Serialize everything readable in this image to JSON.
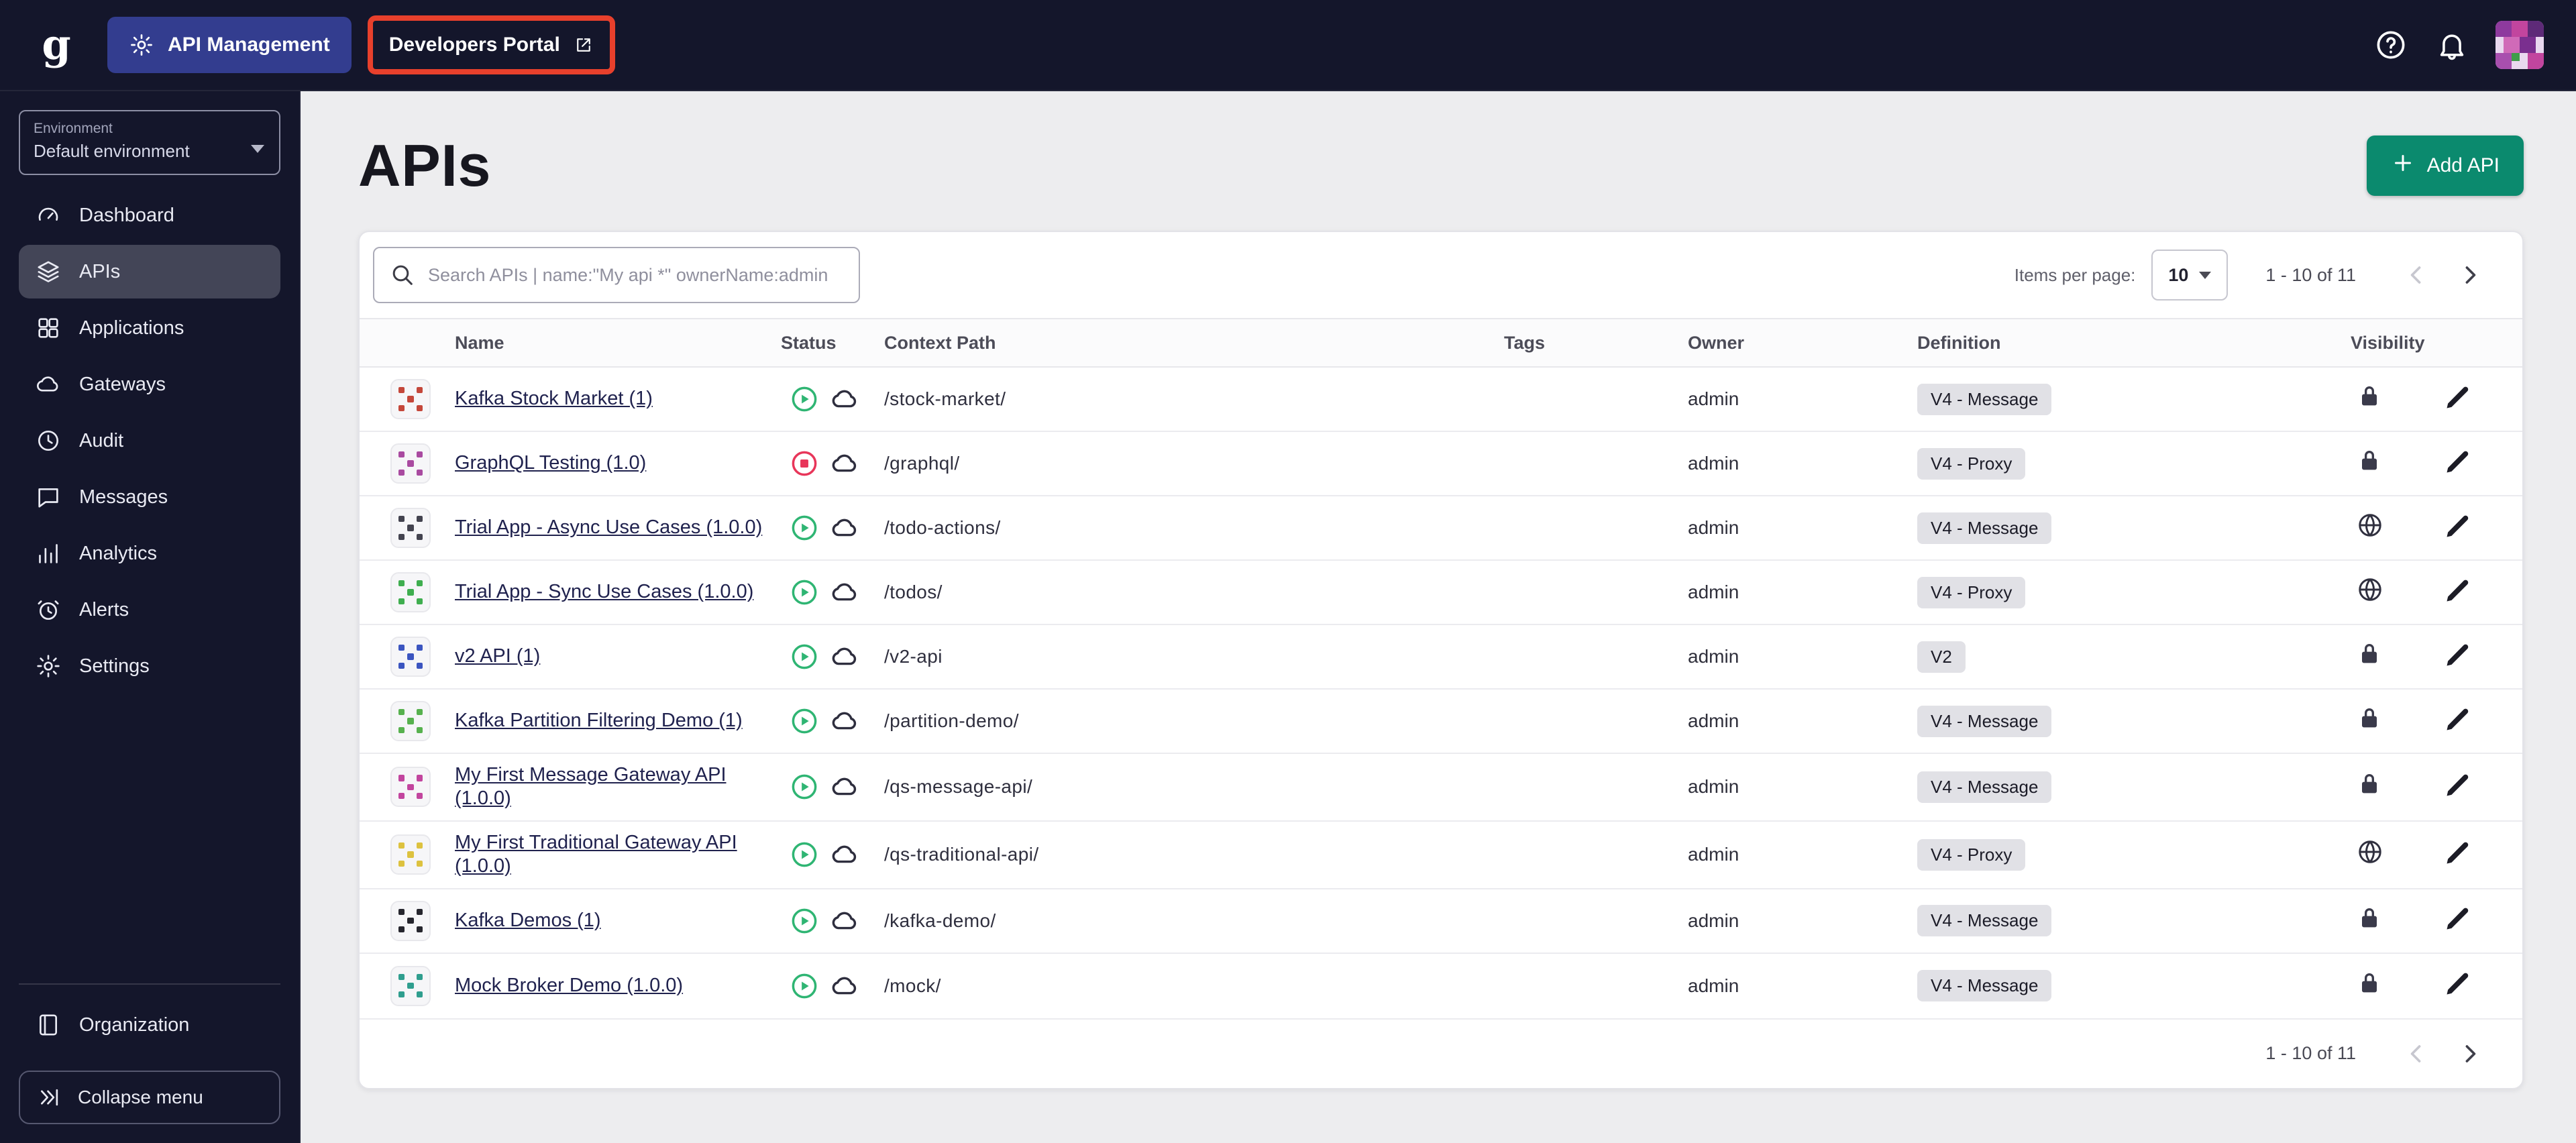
{
  "topbar": {
    "app_label": "API Management",
    "portal_label": "Developers Portal",
    "annotation_color": "#e8402c"
  },
  "sidebar": {
    "environment_label": "Environment",
    "environment_value": "Default environment",
    "items": [
      {
        "label": "Dashboard",
        "icon": "dashboard",
        "active": false
      },
      {
        "label": "APIs",
        "icon": "apis",
        "active": true
      },
      {
        "label": "Applications",
        "icon": "applications",
        "active": false
      },
      {
        "label": "Gateways",
        "icon": "gateways",
        "active": false
      },
      {
        "label": "Audit",
        "icon": "audit",
        "active": false
      },
      {
        "label": "Messages",
        "icon": "messages",
        "active": false
      },
      {
        "label": "Analytics",
        "icon": "analytics",
        "active": false
      },
      {
        "label": "Alerts",
        "icon": "alerts",
        "active": false
      },
      {
        "label": "Settings",
        "icon": "settings",
        "active": false
      }
    ],
    "bottom_items": [
      {
        "label": "Organization",
        "icon": "organization",
        "active": false
      }
    ],
    "collapse_label": "Collapse menu"
  },
  "main": {
    "title": "APIs",
    "add_button_label": "Add API",
    "search_placeholder": "Search APIs | name:\"My api *\" ownerName:admin",
    "pagination": {
      "items_per_page_label": "Items per page:",
      "page_size": "10",
      "range": "1 - 10 of 11"
    },
    "footer": {
      "range": "1 - 10 of 11"
    },
    "table": {
      "headers": [
        "Name",
        "Status",
        "Context Path",
        "Tags",
        "Owner",
        "Definition",
        "Visibility"
      ],
      "rows": [
        {
          "name": "Kafka Stock Market (1)",
          "status": "started",
          "context_path": "/stock-market/",
          "tags": "",
          "owner": "admin",
          "definition": "V4 - Message",
          "visibility": "private",
          "avatar_color": "#c4473a"
        },
        {
          "name": "GraphQL Testing (1.0)",
          "status": "stopped",
          "context_path": "/graphql/",
          "tags": "",
          "owner": "admin",
          "definition": "V4 - Proxy",
          "visibility": "private",
          "avatar_color": "#a94aa0"
        },
        {
          "name": "Trial App - Async Use Cases (1.0.0)",
          "status": "started",
          "context_path": "/todo-actions/",
          "tags": "",
          "owner": "admin",
          "definition": "V4 - Message",
          "visibility": "public",
          "avatar_color": "#43434f"
        },
        {
          "name": "Trial App - Sync Use Cases (1.0.0)",
          "status": "started",
          "context_path": "/todos/",
          "tags": "",
          "owner": "admin",
          "definition": "V4 - Proxy",
          "visibility": "public",
          "avatar_color": "#3fae4f"
        },
        {
          "name": "v2 API (1)",
          "status": "started",
          "context_path": "/v2-api",
          "tags": "",
          "owner": "admin",
          "definition": "V2",
          "visibility": "private",
          "avatar_color": "#3b55c0"
        },
        {
          "name": "Kafka Partition Filtering Demo (1)",
          "status": "started",
          "context_path": "/partition-demo/",
          "tags": "",
          "owner": "admin",
          "definition": "V4 - Message",
          "visibility": "private",
          "avatar_color": "#57b14e"
        },
        {
          "name": "My First Message Gateway API (1.0.0)",
          "status": "started",
          "context_path": "/qs-message-api/",
          "tags": "",
          "owner": "admin",
          "definition": "V4 - Message",
          "visibility": "private",
          "avatar_color": "#c2459e"
        },
        {
          "name": "My First Traditional Gateway API (1.0.0)",
          "status": "started",
          "context_path": "/qs-traditional-api/",
          "tags": "",
          "owner": "admin",
          "definition": "V4 - Proxy",
          "visibility": "public",
          "avatar_color": "#ddc23f"
        },
        {
          "name": "Kafka Demos (1)",
          "status": "started",
          "context_path": "/kafka-demo/",
          "tags": "",
          "owner": "admin",
          "definition": "V4 - Message",
          "visibility": "private",
          "avatar_color": "#26262e"
        },
        {
          "name": "Mock Broker Demo (1.0.0)",
          "status": "started",
          "context_path": "/mock/",
          "tags": "",
          "owner": "admin",
          "definition": "V4 - Message",
          "visibility": "private",
          "avatar_color": "#2f9e8e"
        }
      ]
    }
  },
  "colors": {
    "accent_teal": "#0b8a6e",
    "status_started": "#2fb573",
    "status_stopped": "#e8365a",
    "dark_background": "#14162b",
    "annotation_red": "#e8402c"
  }
}
